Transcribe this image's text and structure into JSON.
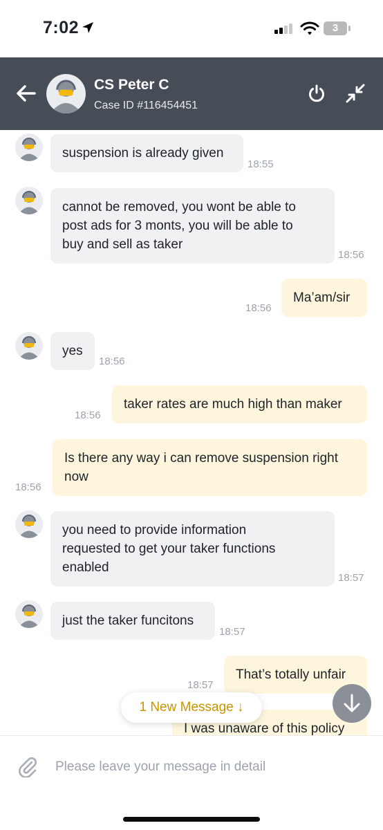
{
  "status_bar": {
    "time": "7:02",
    "battery": "3"
  },
  "header": {
    "agent_name": "CS Peter C",
    "case_id": "Case ID #116454451"
  },
  "messages": [
    {
      "side": "in",
      "text": "suspension is already given",
      "time": "18:55"
    },
    {
      "side": "in",
      "lines": [
        "cannot be removed, you wont be able to",
        "post ads for 3 monts, you will be able to",
        "buy and sell as taker"
      ],
      "time": "18:56"
    },
    {
      "side": "out",
      "text": "Ma’am/sir",
      "time": "18:56"
    },
    {
      "side": "in",
      "text": "yes",
      "time": "18:56"
    },
    {
      "side": "out",
      "text": "taker rates are much high than maker",
      "time": "18:56"
    },
    {
      "side": "out",
      "lines": [
        "Is there any way i can remove suspension right",
        "now"
      ],
      "time": "18:56"
    },
    {
      "side": "in",
      "lines": [
        "you need to provide information",
        "requested to get your taker functions",
        "enabled"
      ],
      "time": "18:57"
    },
    {
      "side": "in",
      "text": "just the taker funcitons",
      "time": "18:57"
    },
    {
      "side": "out",
      "text": "That’s totally unfair",
      "time": "18:57"
    },
    {
      "side": "out",
      "text": "I was unaware of this policy",
      "time": ""
    }
  ],
  "new_message_pill": "1 New Message ↓",
  "composer": {
    "placeholder": "Please leave your message in detail"
  },
  "colors": {
    "header_bg": "#474d57",
    "outgoing_bubble": "#fdf6dd",
    "incoming_bubble": "#f0f1f2",
    "accent": "#c99400"
  },
  "icons": {
    "back": "arrow-left-icon",
    "power": "power-icon",
    "minimize": "minimize-arrows-icon",
    "attach": "paperclip-icon",
    "scroll_down": "arrow-down-icon"
  }
}
